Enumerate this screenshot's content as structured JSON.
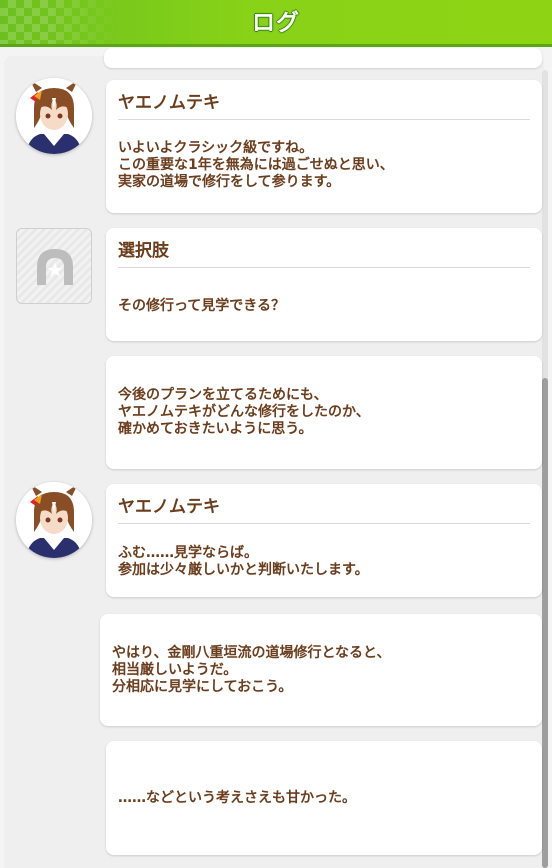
{
  "header": {
    "title": "ログ"
  },
  "colors": {
    "header_green": "#8fd414",
    "text_brown": "#6b3d1c"
  },
  "entries": [
    {
      "speaker": "ヤエノムテキ",
      "text": "いよいよクラシック級ですね。\nこの重要な1年を無為には過ごせぬと思い、\n実家の道場で修行をして参ります。"
    },
    {
      "speaker": "選択肢",
      "text": "その修行って見学できる？"
    },
    {
      "speaker": "",
      "text": "今後のプランを立てるためにも、\nヤエノムテキがどんな修行をしたのか、\n確かめておきたいように思う。"
    },
    {
      "speaker": "ヤエノムテキ",
      "text": "ふむ……見学ならば。\n参加は少々厳しいかと判断いたします。"
    },
    {
      "speaker": "",
      "text": "やはり、金剛八重垣流の道場修行となると、\n相当厳しいようだ。\n分相応に見学にしておこう。"
    },
    {
      "speaker": "",
      "text": "……などという考えさえも甘かった。"
    }
  ]
}
